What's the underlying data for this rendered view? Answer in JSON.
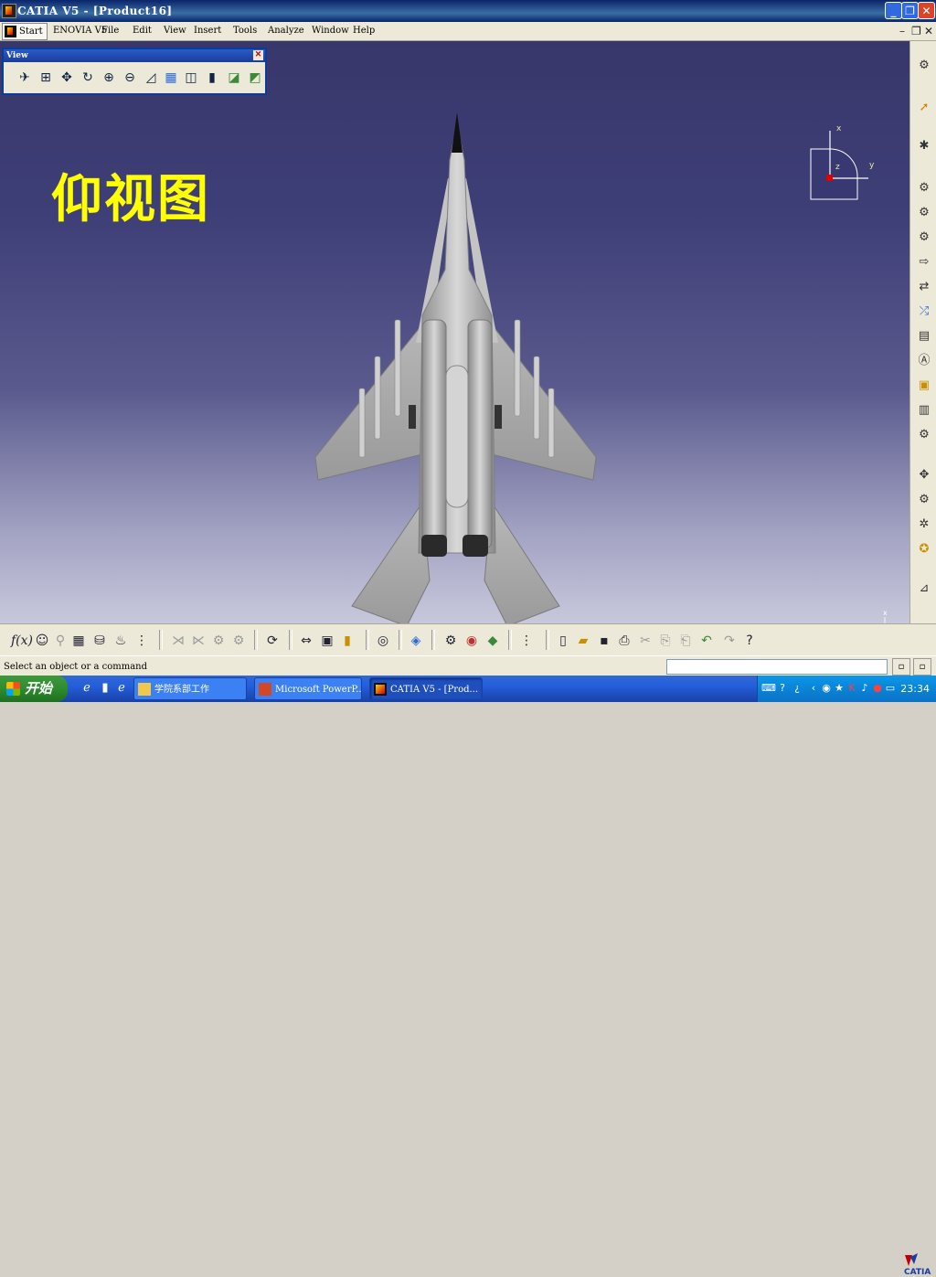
{
  "window": {
    "title": "CATIA V5 - [Product16]"
  },
  "menu": {
    "start": "Start",
    "items": [
      "ENOVIA V5",
      "File",
      "Edit",
      "View",
      "Insert",
      "Tools",
      "Analyze",
      "Window",
      "Help"
    ]
  },
  "view_toolbar": {
    "title": "View",
    "icons": [
      "fly-mode-icon",
      "fit-all-icon",
      "pan-icon",
      "rotate-icon",
      "zoom-in-icon",
      "zoom-out-icon",
      "normal-view-icon",
      "multi-view-icon",
      "quick-view-icon",
      "render-style-icon",
      "hide-show-icon",
      "swap-space-icon"
    ]
  },
  "viewport": {
    "heading": "仰视图",
    "compass_labels": {
      "x": "x",
      "y": "y",
      "z": "z"
    },
    "axis_labels": {
      "x": "x",
      "y": "y"
    }
  },
  "status": {
    "message": "Select an object or a command"
  },
  "taskbar": {
    "start_label": "开始",
    "tasks": [
      {
        "label": "学院系部工作",
        "icon": "folder-icon",
        "active": false
      },
      {
        "label": "Microsoft PowerP...",
        "icon": "powerpoint-icon",
        "active": false
      },
      {
        "label": "CATIA V5 - [Prod...",
        "icon": "catia-icon",
        "active": true
      }
    ],
    "clock": "23:34"
  },
  "colors": {
    "heading": "#ffff00",
    "titlebar": "#0a246a",
    "viewport_top": "#37376b",
    "viewport_bottom": "#c8c8dc"
  }
}
